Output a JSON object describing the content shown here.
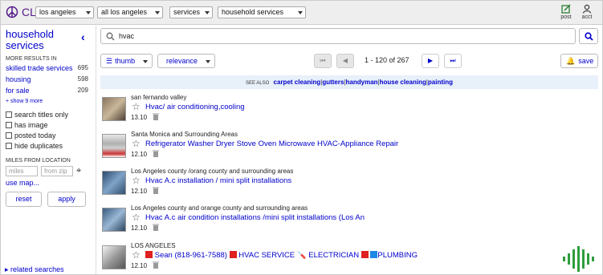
{
  "topbar": {
    "logo_text": "CL",
    "location_select": "los angeles",
    "area_select": "all los angeles",
    "section_select": "services",
    "category_select": "household services",
    "post_label": "post",
    "acct_label": "acct"
  },
  "sidebar": {
    "title": "household services",
    "more_results_header": "MORE RESULTS IN",
    "related_categories": [
      {
        "label": "skilled trade services",
        "count": "695"
      },
      {
        "label": "housing",
        "count": "598"
      },
      {
        "label": "for sale",
        "count": "209"
      }
    ],
    "show_more": "+ show 9 more",
    "filters": [
      "search titles only",
      "has image",
      "posted today",
      "hide duplicates"
    ],
    "miles_header": "MILES FROM LOCATION",
    "miles_placeholder": "miles",
    "zip_placeholder": "from zip",
    "use_map": "use map...",
    "reset_label": "reset",
    "apply_label": "apply",
    "related_searches": "related searches"
  },
  "search": {
    "value": "hvac"
  },
  "toolbar": {
    "view_label": "thumb",
    "sort_label": "relevance",
    "page_info": "1 - 120 of 267",
    "save_label": "save"
  },
  "see_also": {
    "label": "SEE ALSO",
    "links": [
      "carpet cleaning",
      "gutters",
      "handyman",
      "house cleaning",
      "painting"
    ]
  },
  "results": [
    {
      "location": "san fernando valley",
      "title": "Hvac/ air conditioning,cooling",
      "date": "13.10"
    },
    {
      "location": "Santa Monica and Surrounding Areas",
      "title": "Refrigerator Washer Dryer Stove Oven Microwave HVAC-Appliance Repair",
      "date": "12.10"
    },
    {
      "location": "Los Angeles county /orang county and surrounding areas",
      "title": "Hvac A.c installation / mini split installations",
      "date": "12.10"
    },
    {
      "location": "Los Angeles county and orange county and surrounding areas",
      "title": "Hvac A.c air condition installations /mini split installations (Los An",
      "date": "12.10"
    },
    {
      "location": "LOS ANGELES",
      "title_parts": [
        "Sean (818-961-7588)",
        "HVAC SERVICE",
        "ELECTRICIAN",
        "PLUMBING"
      ],
      "date": "12.10"
    }
  ],
  "colors": {
    "link": "#0000cc",
    "logo": "#551a8b",
    "see_also_bg": "#e8f0fa",
    "red_square": "#e02020",
    "plumbing_blue": "#1e88e5",
    "logo_green": "#2e9e3e"
  }
}
